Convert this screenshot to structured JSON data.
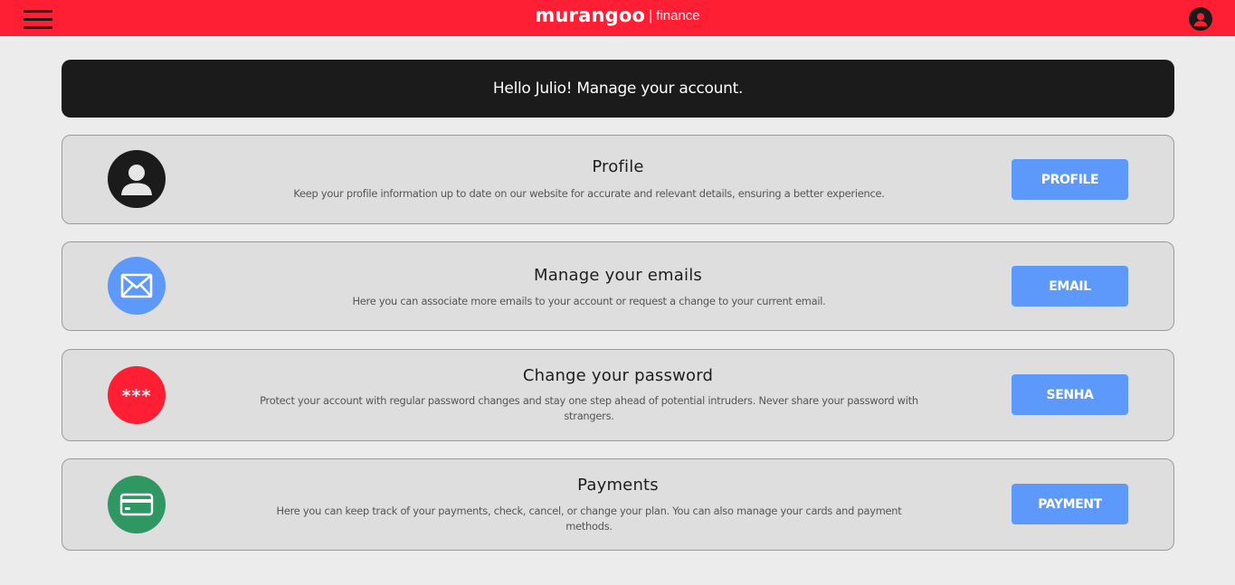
{
  "header": {
    "brand_name": "murangoo",
    "brand_separator": "|",
    "brand_sub": "finance",
    "menu_icon": "hamburger-menu-icon",
    "account_icon": "user-avatar-icon",
    "background_color": "#ff1f35"
  },
  "greeting": {
    "text": "Hello Julio! Manage your account."
  },
  "cards": [
    {
      "icon": "user-icon",
      "icon_color": "#1b1b1b",
      "title": "Profile",
      "description": "Keep your profile information up to date on our website for accurate and relevant details, ensuring a better experience.",
      "button_label": "PROFILE"
    },
    {
      "icon": "envelope-icon",
      "icon_color": "#5d99fb",
      "title": "Manage your emails",
      "description": "Here you can associate more emails to your account or request a change to your current email.",
      "button_label": "EMAIL"
    },
    {
      "icon": "password-asterisks-icon",
      "icon_color": "#ff1f35",
      "icon_text": "***",
      "title": "Change your password",
      "description": "Protect your account with regular password changes and stay one step ahead of potential intruders. Never share your password with strangers.",
      "button_label": "SENHA"
    },
    {
      "icon": "credit-card-icon",
      "icon_color": "#2f9761",
      "title": "Payments",
      "description": "Here you can keep track of your payments, check, cancel, or change your plan. You can also manage your cards and payment methods.",
      "button_label": "PAYMENT"
    }
  ],
  "colors": {
    "accent": "#ff1f35",
    "button": "#5d99fb",
    "page_background": "#ececec",
    "card_background": "#dedede"
  }
}
